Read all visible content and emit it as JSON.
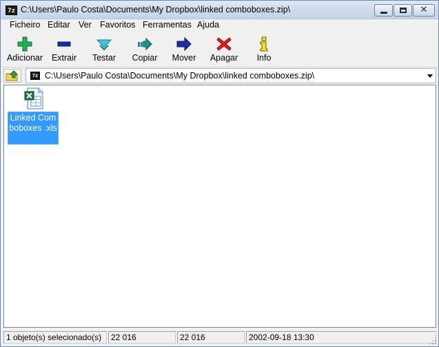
{
  "window": {
    "title": "C:\\Users\\Paulo Costa\\Documents\\My Dropbox\\linked comboboxes.zip\\",
    "app_icon_text": "7z",
    "controls": {
      "minimize": "minimize",
      "maximize": "maximize",
      "close": "✕"
    }
  },
  "menu": {
    "items": [
      "Ficheiro",
      "Editar",
      "Ver",
      "Favoritos",
      "Ferramentas",
      "Ajuda"
    ]
  },
  "toolbar": {
    "buttons": [
      {
        "label": "Adicionar",
        "icon": "plus-icon",
        "color": "#22b14c"
      },
      {
        "label": "Extrair",
        "icon": "minus-icon",
        "color": "#1a2ea8"
      },
      {
        "label": "Testar",
        "icon": "test-chevron-icon",
        "color": "#3cc3d8"
      },
      {
        "label": "Copiar",
        "icon": "copy-arrow-icon",
        "color": "#1f8f8f"
      },
      {
        "label": "Mover",
        "icon": "move-arrow-icon",
        "color": "#1a2ea8"
      },
      {
        "label": "Apagar",
        "icon": "delete-x-icon",
        "color": "#e0201b"
      },
      {
        "label": "Info",
        "icon": "info-icon",
        "color": "#f2e21c"
      }
    ]
  },
  "address": {
    "path": "C:\\Users\\Paulo Costa\\Documents\\My Dropbox\\linked comboboxes.zip\\",
    "icon_text": "7z"
  },
  "files": [
    {
      "name": "Linked Comboboxes .xls",
      "icon": "excel-file-icon",
      "selected": true
    }
  ],
  "status": {
    "selection": "1 objeto(s) selecionado(s)",
    "size": "22 016",
    "packed_size": "22 016",
    "modified": "2002-09-18 13:30"
  },
  "colors": {
    "selection_bg": "#3399ff",
    "titlebar": "#cfdcec"
  }
}
